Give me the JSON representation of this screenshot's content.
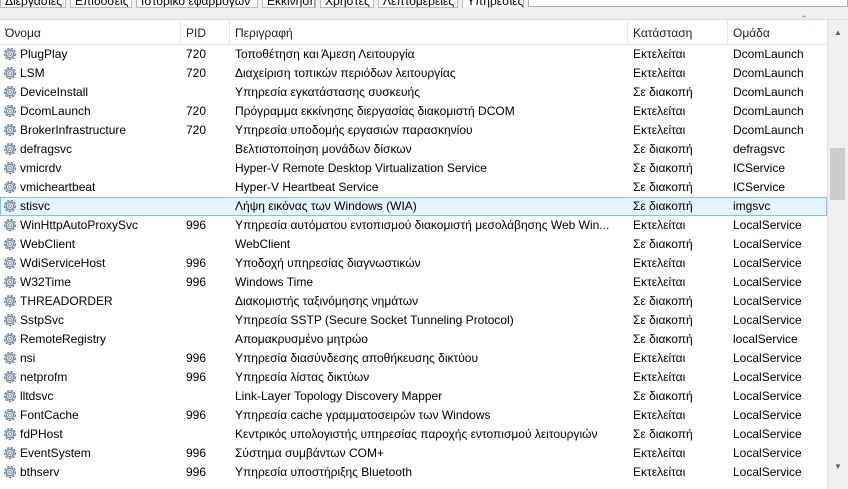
{
  "tabs": [
    {
      "label": "Διεργασίες"
    },
    {
      "label": "Επιδόσεις"
    },
    {
      "label": "Ιστορικό εφαρμογών"
    },
    {
      "label": "Εκκίνηση"
    },
    {
      "label": "Χρήστες"
    },
    {
      "label": "Λεπτομέρειες"
    },
    {
      "label": "Υπηρεσίες"
    }
  ],
  "columns": {
    "name": "Όνομα",
    "pid": "PID",
    "description": "Περιγραφή",
    "status": "Κατάσταση",
    "group": "Ομάδα"
  },
  "icons": {
    "service": "gear-icon",
    "scroll_up": "chevron-up-icon",
    "scroll_down": "chevron-down-icon"
  },
  "colors": {
    "selection_bg": "#e5f3fb",
    "selection_border": "#7fc4ee",
    "sort_arrow": "#5a8fcf"
  },
  "rows": [
    {
      "name": "PlugPlay",
      "pid": "720",
      "description": "Τοποθέτηση και Άμεση Λειτουργία",
      "status": "Εκτελείται",
      "group": "DcomLaunch"
    },
    {
      "name": "LSM",
      "pid": "720",
      "description": "Διαχείριση τοπικών περιόδων λειτουργίας",
      "status": "Εκτελείται",
      "group": "DcomLaunch"
    },
    {
      "name": "DeviceInstall",
      "pid": "",
      "description": "Υπηρεσία εγκατάστασης συσκευής",
      "status": "Σε διακοπή",
      "group": "DcomLaunch"
    },
    {
      "name": "DcomLaunch",
      "pid": "720",
      "description": "Πρόγραμμα εκκίνησης διεργασίας διακομιστή DCOM",
      "status": "Εκτελείται",
      "group": "DcomLaunch"
    },
    {
      "name": "BrokerInfrastructure",
      "pid": "720",
      "description": "Υπηρεσία υποδομής εργασιών παρασκηνίου",
      "status": "Εκτελείται",
      "group": "DcomLaunch"
    },
    {
      "name": "defragsvc",
      "pid": "",
      "description": "Βελτιστοποίηση μονάδων δίσκων",
      "status": "Σε διακοπή",
      "group": "defragsvc"
    },
    {
      "name": "vmicrdv",
      "pid": "",
      "description": "Hyper-V Remote Desktop Virtualization Service",
      "status": "Σε διακοπή",
      "group": "ICService"
    },
    {
      "name": "vmicheartbeat",
      "pid": "",
      "description": "Hyper-V Heartbeat Service",
      "status": "Σε διακοπή",
      "group": "ICService"
    },
    {
      "name": "stisvc",
      "pid": "",
      "description": "Λήψη εικόνας των Windows (WIA)",
      "status": "Σε διακοπή",
      "group": "imgsvc",
      "selected": true
    },
    {
      "name": "WinHttpAutoProxySvc",
      "pid": "996",
      "description": "Υπηρεσία αυτόματου εντοπισμού διακομιστή μεσολάβησης Web Win...",
      "status": "Εκτελείται",
      "group": "LocalService"
    },
    {
      "name": "WebClient",
      "pid": "",
      "description": "WebClient",
      "status": "Σε διακοπή",
      "group": "LocalService"
    },
    {
      "name": "WdiServiceHost",
      "pid": "996",
      "description": "Υποδοχή υπηρεσίας διαγνωστικών",
      "status": "Εκτελείται",
      "group": "LocalService"
    },
    {
      "name": "W32Time",
      "pid": "996",
      "description": "Windows Time",
      "status": "Εκτελείται",
      "group": "LocalService"
    },
    {
      "name": "THREADORDER",
      "pid": "",
      "description": "Διακομιστής ταξινόμησης νημάτων",
      "status": "Σε διακοπή",
      "group": "LocalService"
    },
    {
      "name": "SstpSvc",
      "pid": "",
      "description": "Υπηρεσία SSTP (Secure Socket Tunneling Protocol)",
      "status": "Σε διακοπή",
      "group": "LocalService"
    },
    {
      "name": "RemoteRegistry",
      "pid": "",
      "description": "Απομακρυσμένο μητρώο",
      "status": "Σε διακοπή",
      "group": "localService"
    },
    {
      "name": "nsi",
      "pid": "996",
      "description": "Υπηρεσία διασύνδεσης αποθήκευσης δικτύου",
      "status": "Εκτελείται",
      "group": "LocalService"
    },
    {
      "name": "netprofm",
      "pid": "996",
      "description": "Υπηρεσία λίστας δικτύων",
      "status": "Εκτελείται",
      "group": "LocalService"
    },
    {
      "name": "lltdsvc",
      "pid": "",
      "description": "Link-Layer Topology Discovery Mapper",
      "status": "Σε διακοπή",
      "group": "LocalService"
    },
    {
      "name": "FontCache",
      "pid": "996",
      "description": "Υπηρεσία cache γραμματοσειρών των Windows",
      "status": "Εκτελείται",
      "group": "LocalService"
    },
    {
      "name": "fdPHost",
      "pid": "",
      "description": "Κεντρικός υπολογιστής υπηρεσίας παροχής εντοπισμού λειτουργιών",
      "status": "Σε διακοπή",
      "group": "LocalService"
    },
    {
      "name": "EventSystem",
      "pid": "996",
      "description": "Σύστημα συμβάντων COM+",
      "status": "Εκτελείται",
      "group": "LocalService"
    },
    {
      "name": "bthserv",
      "pid": "996",
      "description": "Υπηρεσία υποστήριξης Bluetooth",
      "status": "Εκτελείται",
      "group": "LocalService"
    }
  ]
}
